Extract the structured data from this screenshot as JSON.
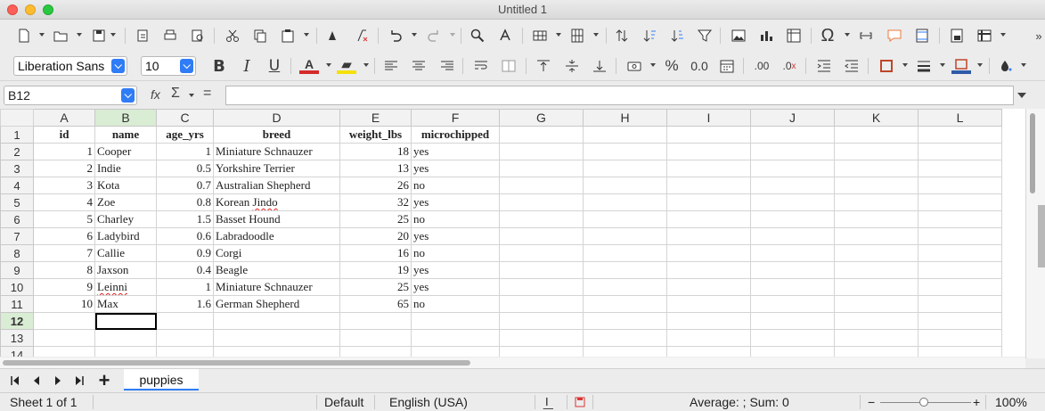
{
  "window": {
    "title": "Untitled 1"
  },
  "toolbar": {
    "font_name": "Liberation Sans",
    "font_size": "10",
    "font_color": "#d42a2a",
    "highlight_color": "#f5e10a",
    "border_color": "#c0452a",
    "cell_bg_color": "#2f5aa8"
  },
  "formula_bar": {
    "cell_ref": "B12",
    "func_icon": "fx",
    "sum_icon": "Σ",
    "equals": "=",
    "content": ""
  },
  "sheet": {
    "columns": [
      "A",
      "B",
      "C",
      "D",
      "E",
      "F",
      "G",
      "H",
      "I",
      "J",
      "K",
      "L"
    ],
    "selected_column": "B",
    "selected_row": "12",
    "header_row": [
      "id",
      "name",
      "age_yrs",
      "breed",
      "weight_lbs",
      "microchipped"
    ],
    "rows": [
      [
        "1",
        "Cooper",
        "1",
        "Miniature Schnauzer",
        "18",
        "yes"
      ],
      [
        "2",
        "Indie",
        "0.5",
        "Yorkshire Terrier",
        "13",
        "yes"
      ],
      [
        "3",
        "Kota",
        "0.7",
        "Australian Shepherd",
        "26",
        "no"
      ],
      [
        "4",
        "Zoe",
        "0.8",
        "Korean Jindo",
        "32",
        "yes"
      ],
      [
        "5",
        "Charley",
        "1.5",
        "Basset Hound",
        "25",
        "no"
      ],
      [
        "6",
        "Ladybird",
        "0.6",
        "Labradoodle",
        "20",
        "yes"
      ],
      [
        "7",
        "Callie",
        "0.9",
        "Corgi",
        "16",
        "no"
      ],
      [
        "8",
        "Jaxson",
        "0.4",
        "Beagle",
        "19",
        "yes"
      ],
      [
        "9",
        "Leinni",
        "1",
        "Miniature Schnauzer",
        "25",
        "yes"
      ],
      [
        "10",
        "Max",
        "1.6",
        "German Shepherd",
        "65",
        "no"
      ]
    ],
    "row_numbers": [
      "1",
      "2",
      "3",
      "4",
      "5",
      "6",
      "7",
      "8",
      "9",
      "10",
      "11",
      "12",
      "13",
      "14"
    ]
  },
  "tabs": {
    "add_label": "+",
    "active_tab": "puppies"
  },
  "status": {
    "sheet_info": "Sheet 1 of 1",
    "page_style": "Default",
    "language": "English (USA)",
    "selection_summary": "Average: ; Sum: 0",
    "zoom_minus": "−",
    "zoom_plus": "+",
    "zoom": "100%"
  }
}
